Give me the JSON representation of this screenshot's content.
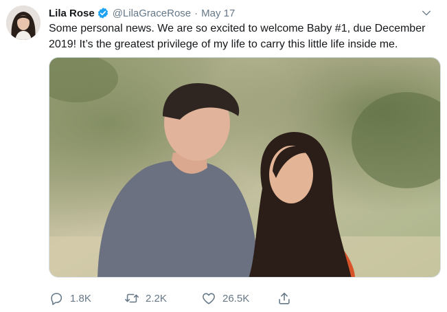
{
  "tweet": {
    "author_name": "Lila Rose",
    "handle": "@LilaGraceRose",
    "separator": "·",
    "date": "May 17",
    "text": "Some personal news. We are so excited to welcome Baby #1, due December 2019! It’s the greatest privilege of my life to carry this little life inside me.",
    "reply_count": "1.8K",
    "retweet_count": "2.2K",
    "like_count": "26.5K"
  },
  "icons": {
    "verified": "verified-badge-icon",
    "caret": "chevron-down-icon",
    "reply": "reply-icon",
    "retweet": "retweet-icon",
    "like": "heart-icon",
    "share": "share-icon"
  },
  "colors": {
    "text": "#14171a",
    "muted": "#657786",
    "verified": "#1da1f2"
  }
}
